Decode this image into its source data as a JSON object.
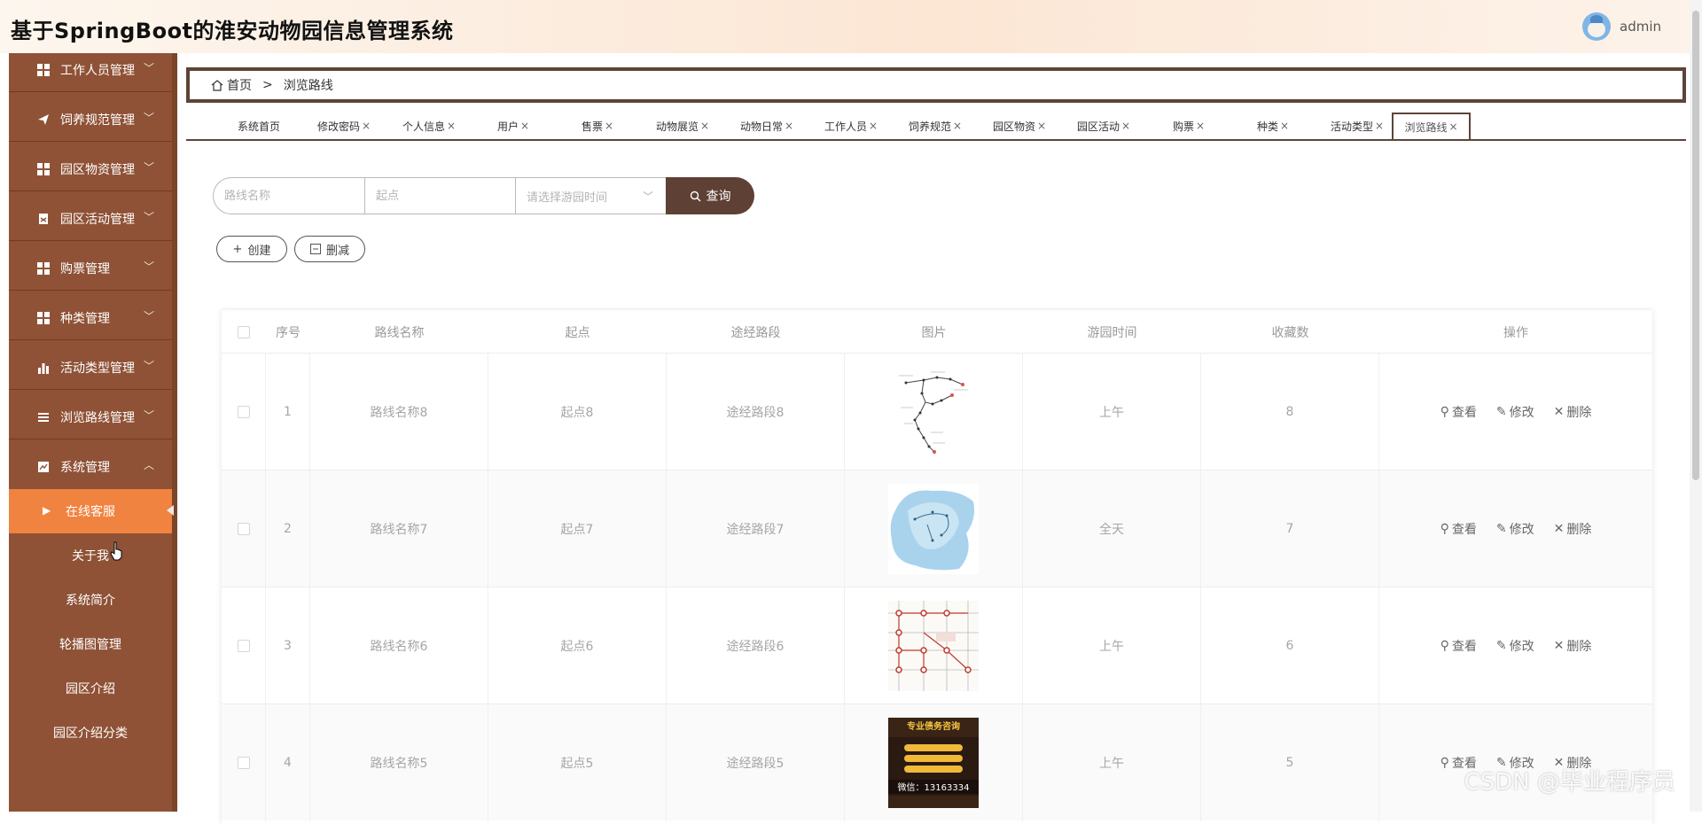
{
  "header": {
    "title": "基于SpringBoot的淮安动物园信息管理系统",
    "username": "admin"
  },
  "sidebar": {
    "menus": [
      {
        "label": "工作人员管理",
        "icon": "grid-icon"
      },
      {
        "label": "饲养规范管理",
        "icon": "send-icon"
      },
      {
        "label": "园区物资管理",
        "icon": "grid-icon"
      },
      {
        "label": "园区活动管理",
        "icon": "clipboard-icon"
      },
      {
        "label": "购票管理",
        "icon": "grid-icon"
      },
      {
        "label": "种类管理",
        "icon": "grid-icon"
      },
      {
        "label": "活动类型管理",
        "icon": "bar-chart-icon"
      },
      {
        "label": "浏览路线管理",
        "icon": "list-icon"
      },
      {
        "label": "系统管理",
        "icon": "chart-icon"
      }
    ],
    "submenu": [
      {
        "label": "在线客服",
        "active": true
      },
      {
        "label": "关于我"
      },
      {
        "label": "系统简介"
      },
      {
        "label": "轮播图管理"
      },
      {
        "label": "园区介绍"
      },
      {
        "label": "园区介绍分类"
      }
    ]
  },
  "breadcrumb": {
    "home": "首页",
    "separator": ">",
    "current": "浏览路线"
  },
  "tabs": [
    {
      "label": "系统首页",
      "closable": false
    },
    {
      "label": "修改密码",
      "closable": true
    },
    {
      "label": "个人信息",
      "closable": true
    },
    {
      "label": "用户",
      "closable": true
    },
    {
      "label": "售票",
      "closable": true
    },
    {
      "label": "动物展览",
      "closable": true
    },
    {
      "label": "动物日常",
      "closable": true
    },
    {
      "label": "工作人员",
      "closable": true
    },
    {
      "label": "饲养规范",
      "closable": true
    },
    {
      "label": "园区物资",
      "closable": true
    },
    {
      "label": "园区活动",
      "closable": true
    },
    {
      "label": "购票",
      "closable": true
    },
    {
      "label": "种类",
      "closable": true
    },
    {
      "label": "活动类型",
      "closable": true
    },
    {
      "label": "浏览路线",
      "closable": true,
      "active": true
    }
  ],
  "tab_close_glyph": "×",
  "search": {
    "route_name_placeholder": "路线名称",
    "start_placeholder": "起点",
    "time_placeholder": "请选择游园时间",
    "button_label": "查询"
  },
  "actions": {
    "create_label": "创建",
    "delete_label": "删减"
  },
  "table": {
    "columns": [
      "序号",
      "路线名称",
      "起点",
      "途经路段",
      "图片",
      "游园时间",
      "收藏数",
      "操作"
    ],
    "rows": [
      {
        "index": "1",
        "name": "路线名称8",
        "start": "起点8",
        "via": "途经路段8",
        "image": "route-map-line",
        "time": "上午",
        "favorites": "8"
      },
      {
        "index": "2",
        "name": "路线名称7",
        "start": "起点7",
        "via": "途经路段7",
        "image": "route-map-area",
        "time": "全天",
        "favorites": "7"
      },
      {
        "index": "3",
        "name": "路线名称6",
        "start": "起点6",
        "via": "途经路段6",
        "image": "route-map-grid",
        "time": "上午",
        "favorites": "6"
      },
      {
        "index": "4",
        "name": "路线名称5",
        "start": "起点5",
        "via": "途经路段5",
        "image": "ad-poster",
        "time": "上午",
        "favorites": "5"
      }
    ],
    "row_actions": {
      "view": "查看",
      "edit": "修改",
      "delete": "删除"
    }
  },
  "poster": {
    "headline": "专业债务咨询",
    "phone": "微信：13163334"
  },
  "watermark": "CSDN @毕业程序员",
  "colors": {
    "sidebar": "#8f5236",
    "active_sub": "#f0833f",
    "primary_button": "#5e4034",
    "accent_border": "#5d4437"
  }
}
